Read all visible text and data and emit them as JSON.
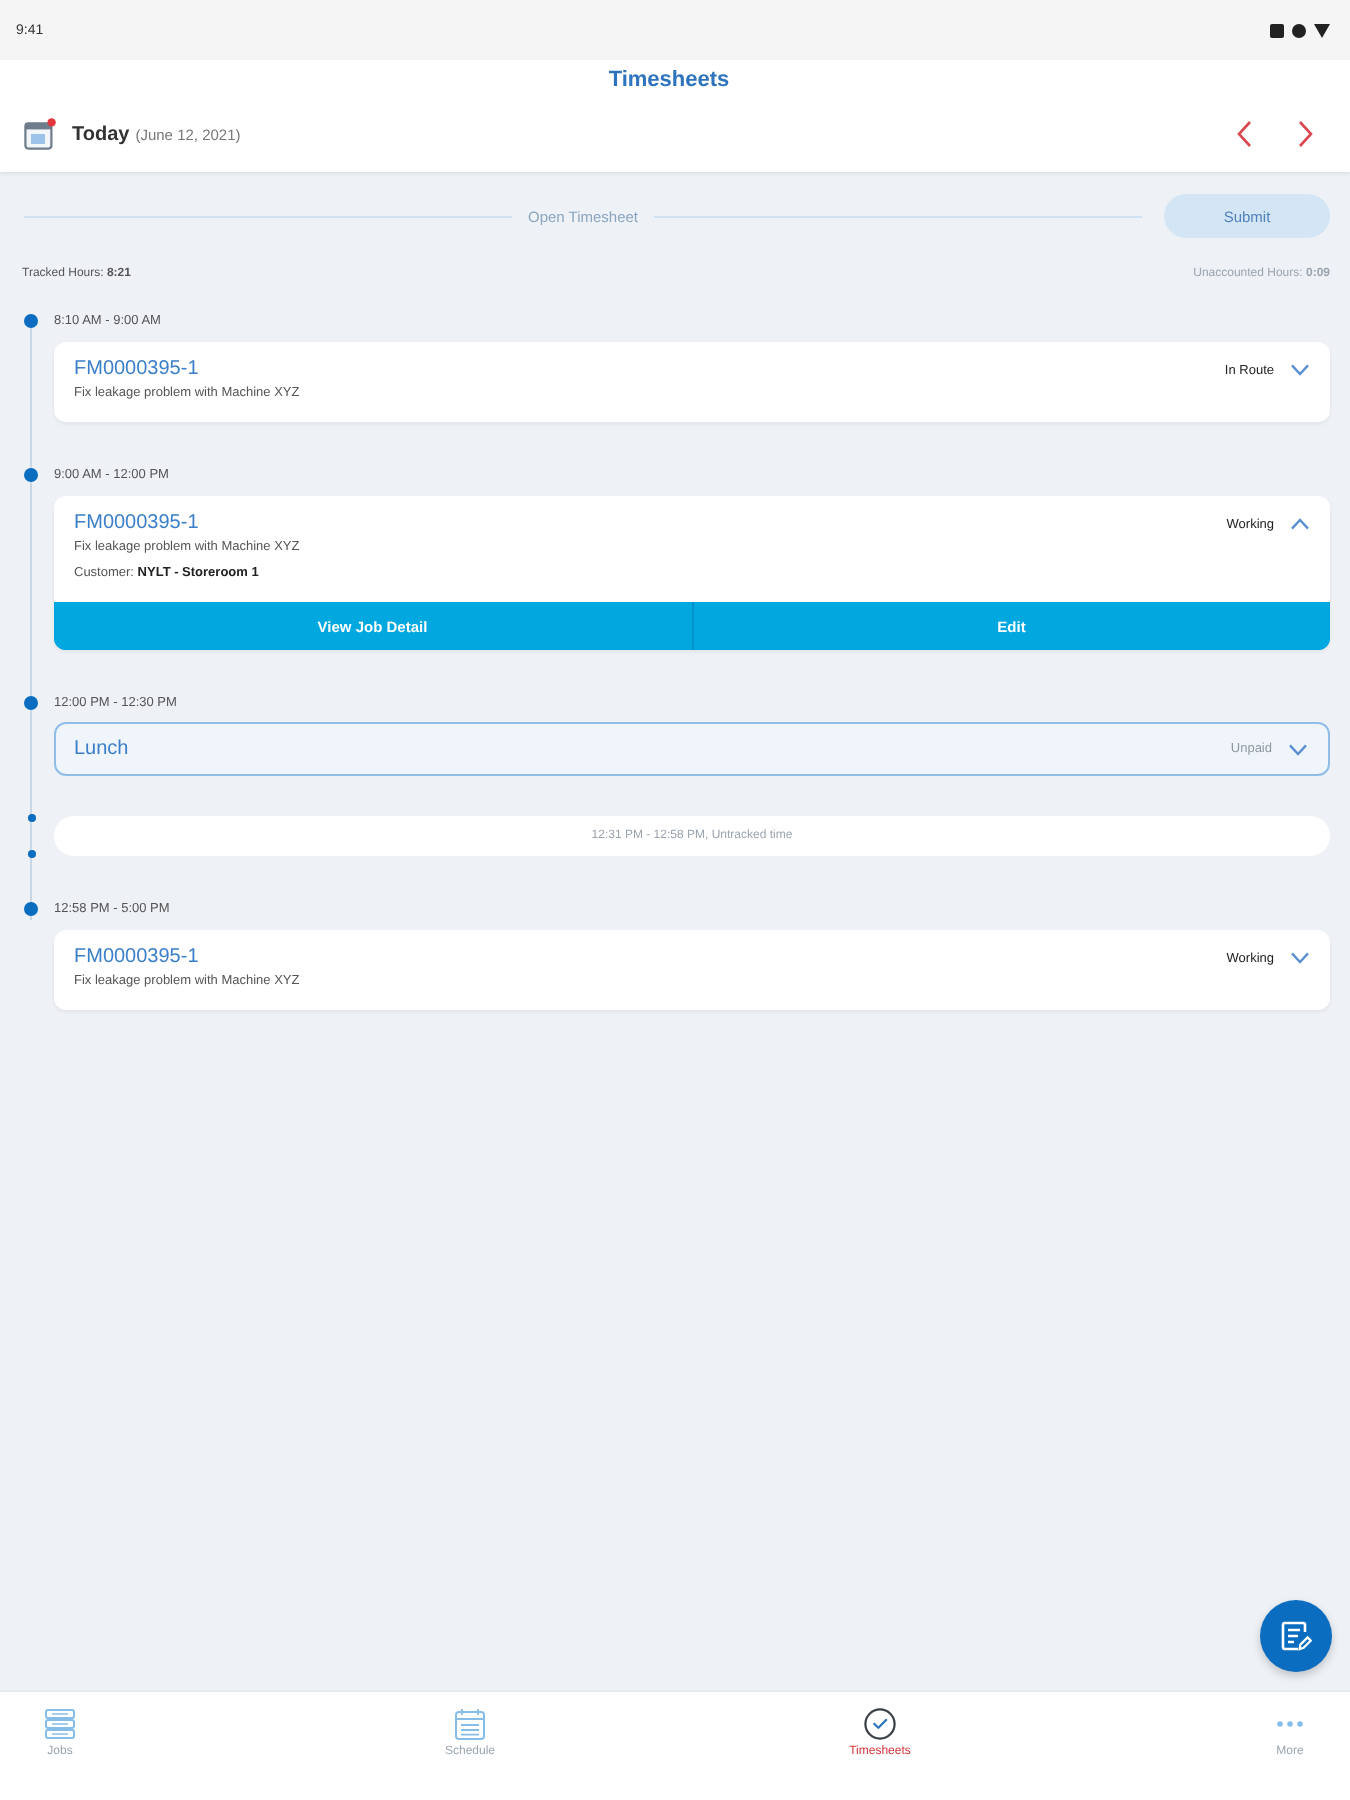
{
  "status_bar": {
    "time": "9:41"
  },
  "header": {
    "title": "Timesheets",
    "date_label": "Today",
    "date": "(June 12, 2021)"
  },
  "toolbar": {
    "section_label": "Open Timesheet",
    "submit": {
      "label": "Submit",
      "disabled": true
    }
  },
  "summary": {
    "tracked": "Tracked Hours: **8:21**",
    "unaccounted": "Unaccounted Hours: **0:09**"
  },
  "timeline": [
    {
      "kind": "job",
      "time": "8:10 AM - 9:00 AM",
      "id": "FM0000395-1",
      "description": "Fix leakage problem with Machine XYZ",
      "status": "In Route",
      "expanded": false
    },
    {
      "kind": "job",
      "time": "9:00 AM - 12:00 PM",
      "id": "FM0000395-1",
      "description": "Fix leakage problem with Machine XYZ",
      "customer": "Customer: **NYLT - Storeroom 1**",
      "status": "Working",
      "expanded": true,
      "actions": [
        "View Job Detail",
        "Edit"
      ]
    },
    {
      "kind": "break",
      "time": "12:00 PM - 12:30 PM",
      "label": "Lunch",
      "status": "Unpaid",
      "expanded": false
    },
    {
      "kind": "gap",
      "text": "12:31 PM - 12:58 PM, Untracked time"
    },
    {
      "kind": "job",
      "time": "12:58 PM - 5:00 PM",
      "id": "FM0000395-1",
      "description": "Fix leakage problem with Machine XYZ",
      "status": "Working",
      "expanded": false
    }
  ],
  "tabs": [
    {
      "label": "Jobs",
      "selected": false
    },
    {
      "label": "Schedule",
      "selected": false
    },
    {
      "label": "Timesheets",
      "selected": true
    },
    {
      "label": "More",
      "selected": false
    }
  ]
}
